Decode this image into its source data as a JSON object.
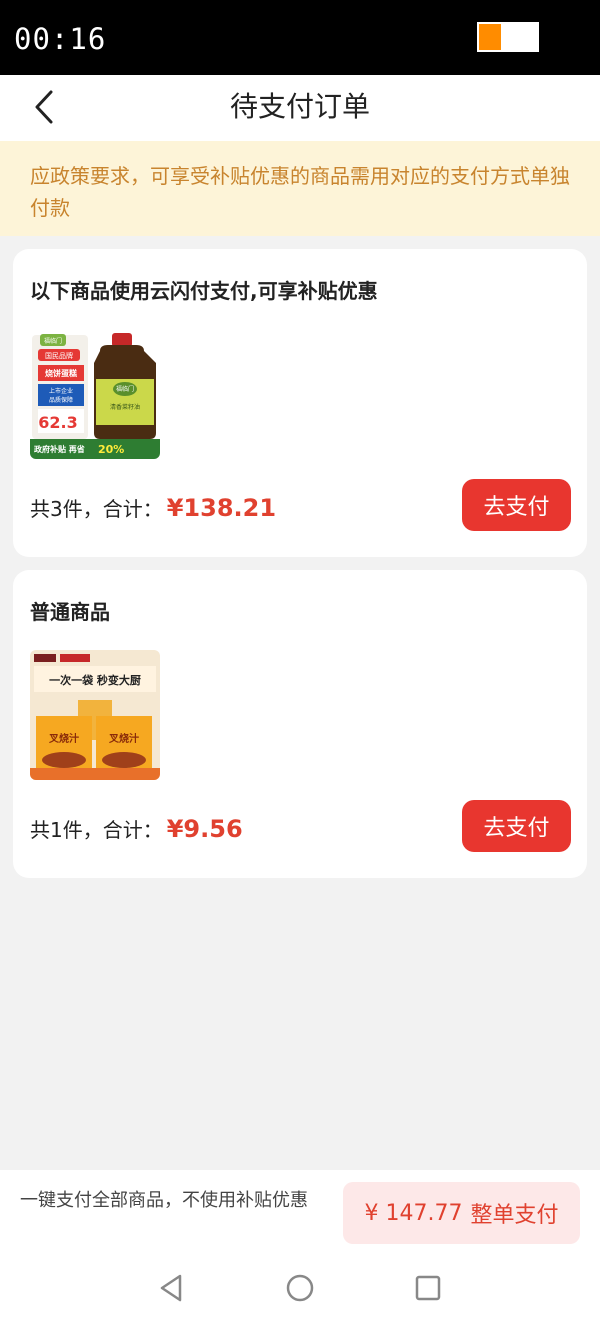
{
  "status_bar": {
    "time": "00:16",
    "battery_level": 0.38,
    "battery_color": "#ff8c00"
  },
  "header": {
    "title": "待支付订单",
    "back_icon": "chevron-left-icon"
  },
  "notice": {
    "text": "应政策要求，可享受补贴优惠的商品需用对应的支付方式单独付款"
  },
  "orders": [
    {
      "title": "以下商品使用云闪付支付,可享补贴优惠",
      "summary_label": "共3件，合计：",
      "total": "¥138.21",
      "pay_label": "去支付",
      "thumb_texts": [
        "福临门",
        "国民品牌",
        "烧饼蛋糕",
        "上市企业",
        "品质保障",
        "62.3",
        "政府补贴 再省",
        "20%",
        "福临门",
        "清香菜籽油"
      ]
    },
    {
      "title": "普通商品",
      "summary_label": "共1件，合计：",
      "total": "¥9.56",
      "pay_label": "去支付",
      "thumb_texts": [
        "一次一袋 秒变大厨",
        "叉烧汁",
        "叉烧汁"
      ]
    }
  ],
  "bottom_bar": {
    "note": "一键支付全部商品，不使用补贴优惠",
    "total": "¥ 147.77",
    "pay_label": "整单支付"
  },
  "colors": {
    "accent": "#e8362f",
    "price": "#e0412f",
    "notice_bg": "#fdf4d8",
    "notice_text": "#c8842e"
  }
}
